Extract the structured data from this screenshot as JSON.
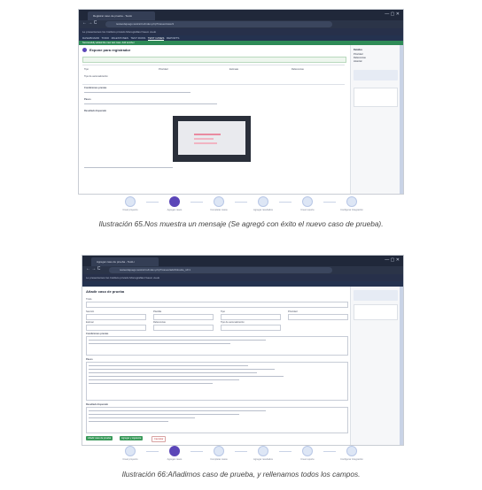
{
  "shot1": {
    "tab_label": "Registrar caso de prueba - TestLi",
    "url": "testeodejuego.testrail.io/index.php?/cases/view/1",
    "bookmarks": "Le presentamos Go   Instituto privado   Monografias   Nuevo vuelo",
    "nav": [
      "DASHBOARD",
      "TODO",
      "MILESTONES",
      "TEST RUNS",
      "TEST CASES",
      "REPORTS"
    ],
    "nav_active": "TEST CASES",
    "banner": "Successfully added the new test case. Add another",
    "case_title": "Expone para registrador",
    "sidebar_title": "Detalles",
    "sidebar_items": [
      "Prioridad",
      "Referencias",
      "Historial"
    ],
    "labels": {
      "type": "Tipo",
      "priority": "Prioridad",
      "estimate": "Estimate",
      "references": "Referencias",
      "automation": "Tipo de automatización",
      "preconditions": "Condiciones previas",
      "steps": "Pasos",
      "expected": "Resultado Esperado"
    }
  },
  "shot2": {
    "tab_label": "Agregar caso de prueba - TestLi",
    "url": "testeodejuego.testrail.io/index.php?/cases/add/1&suite_id=1",
    "bookmarks": "Le presentamos Go   Instituto privado   Monografias   Nuevo vuelo",
    "page_title": "Añadir caso de prueba",
    "fields": [
      "Título",
      "Sección",
      "Plantilla",
      "Tipo",
      "Prioridad",
      "Estimar",
      "Referencias",
      "Tipo de automatización"
    ],
    "preconditions_label": "Condiciones previas",
    "steps_label": "Pasos",
    "expected_label": "Resultado Esperado",
    "add_button": "Añadir caso de prueba",
    "add_next_button": "Agregar y siguiente",
    "cancel_button": "Cancelar"
  },
  "workflow": [
    {
      "label": "Crear proyecto",
      "active": false
    },
    {
      "label": "Agregar casos",
      "active": true
    },
    {
      "label": "Completar casos",
      "active": false
    },
    {
      "label": "Agregar resultados",
      "active": false
    },
    {
      "label": "Crear reporte",
      "active": false
    },
    {
      "label": "Configurar Integración",
      "active": false
    }
  ],
  "captions": {
    "fig65": "Ilustración 65.Nos muestra un mensaje (Se agregó con éxito el nuevo caso de prueba).",
    "fig66": "Ilustración 66:Añadimos caso de prueba, y rellenamos todos los campos."
  },
  "colors": {
    "chrome": "#20283a",
    "accent": "#5b46b8",
    "success": "#2e8b57"
  }
}
